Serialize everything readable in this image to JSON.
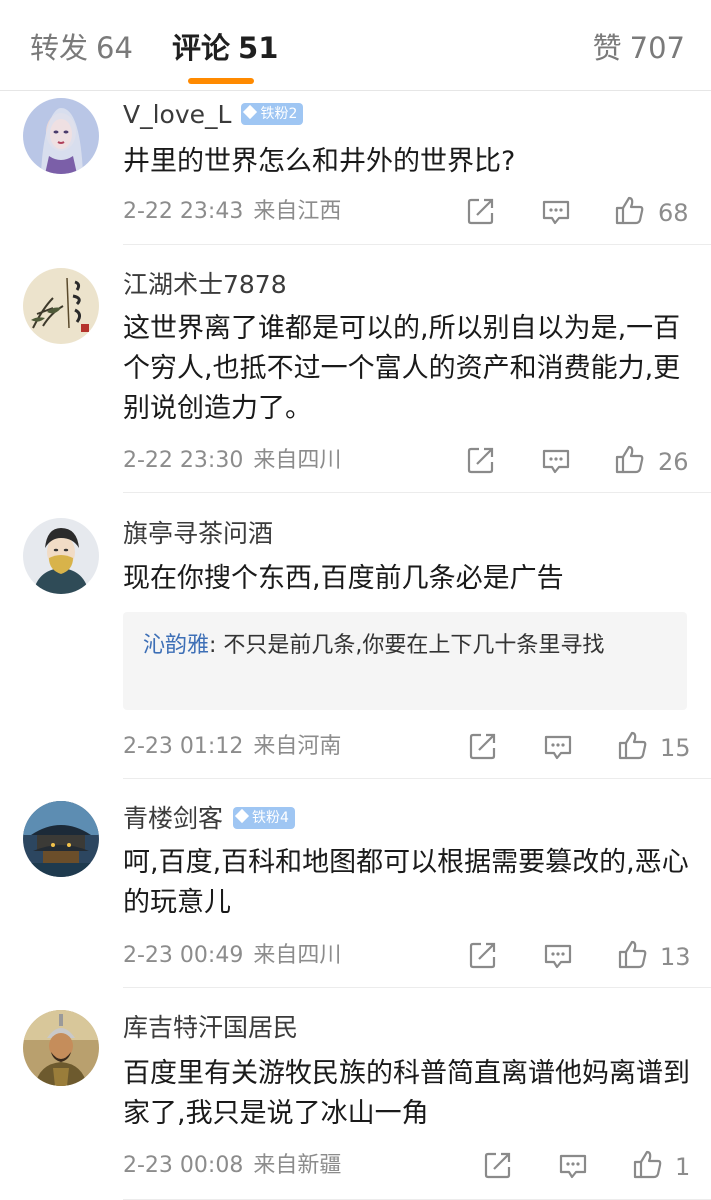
{
  "tabs": {
    "repost": {
      "label": "转发",
      "count": "64"
    },
    "comment": {
      "label": "评论",
      "count": "51"
    },
    "like": {
      "label": "赞",
      "count": "707"
    }
  },
  "comments": [
    {
      "user": "V_love_L",
      "badge": "铁粉2",
      "text": "井里的世界怎么和井外的世界比?",
      "time": "2-22 23:43",
      "location": "来自江西",
      "likes": "68",
      "avatar": "portrait-avatar"
    },
    {
      "user": "江湖术士7878",
      "badge": "",
      "text": "这世界离了谁都是可以的,所以别自以为是,一百个穷人,也抵不过一个富人的资产和消费能力,更别说创造力了。",
      "time": "2-22 23:30",
      "location": "来自四川",
      "likes": "26",
      "avatar": "calligraphy-avatar"
    },
    {
      "user": "旗亭寻茶问酒",
      "badge": "",
      "text": "现在你搜个东西,百度前几条必是广告",
      "reply": {
        "user": "沁韵雅",
        "text": "不只是前几条,你要在上下几十条里寻找"
      },
      "time": "2-23 01:12",
      "location": "来自河南",
      "likes": "15",
      "avatar": "masked-figure-avatar"
    },
    {
      "user": "青楼剑客",
      "badge": "铁粉4",
      "text": "呵,百度,百科和地图都可以根据需要篡改的,恶心的玩意儿",
      "time": "2-23 00:49",
      "location": "来自四川",
      "likes": "13",
      "avatar": "pavilion-avatar"
    },
    {
      "user": "库吉特汗国居民",
      "badge": "",
      "text": "百度里有关游牧民族的科普简直离谱他妈离谱到家了,我只是说了冰山一角",
      "time": "2-23 00:08",
      "location": "来自新疆",
      "likes": "1",
      "avatar": "warrior-avatar"
    }
  ],
  "icons": {
    "repost": "share-icon",
    "comment": "comment-icon",
    "like": "thumbs-up-icon",
    "badge": "diamond-icon"
  },
  "colors": {
    "accent": "#ff8a00",
    "reply_name": "#3d6fb6",
    "badge": "#9fc6f3"
  }
}
